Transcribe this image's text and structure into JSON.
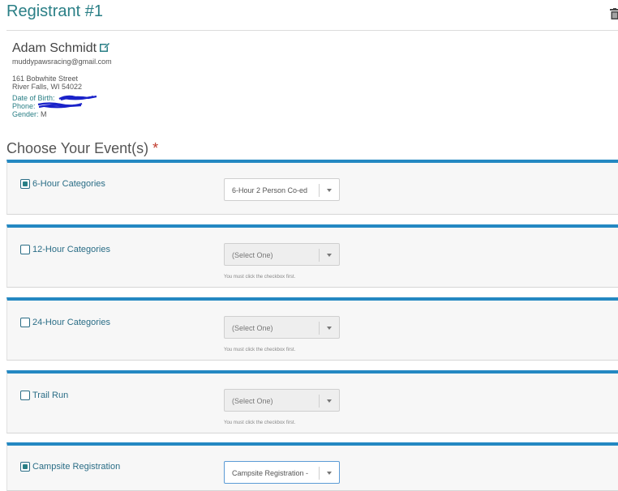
{
  "registrant": {
    "title": "Registrant #1",
    "name": "Adam Schmidt",
    "email": "muddypawsracing@gmail.com",
    "address_line1": "161 Bobwhite Street",
    "address_line2": "River Falls, WI 54022",
    "dob_label": "Date of Birth:",
    "phone_label": "Phone:",
    "gender_label": "Gender:",
    "gender_value": "M"
  },
  "events": {
    "heading": "Choose Your Event(s)",
    "required_mark": "*",
    "items": [
      {
        "label": "6-Hour Categories",
        "checked": true,
        "value": "6-Hour 2 Person Co-ed",
        "help": ""
      },
      {
        "label": "12-Hour Categories",
        "checked": false,
        "value": "(Select One)",
        "help": "You must click the checkbox first."
      },
      {
        "label": "24-Hour Categories",
        "checked": false,
        "value": "(Select One)",
        "help": "You must click the checkbox first."
      },
      {
        "label": "Trail Run",
        "checked": false,
        "value": "(Select One)",
        "help": "You must click the checkbox first."
      },
      {
        "label": "Campsite Registration",
        "checked": true,
        "value": "Campsite Registration -",
        "help": ""
      }
    ]
  },
  "icons": [
    "trash-icon",
    "edit-icon",
    "chevron-down-icon"
  ],
  "colors": {
    "accent": "#2a7f86",
    "card_border": "#2488c2",
    "required": "#c0392b"
  }
}
